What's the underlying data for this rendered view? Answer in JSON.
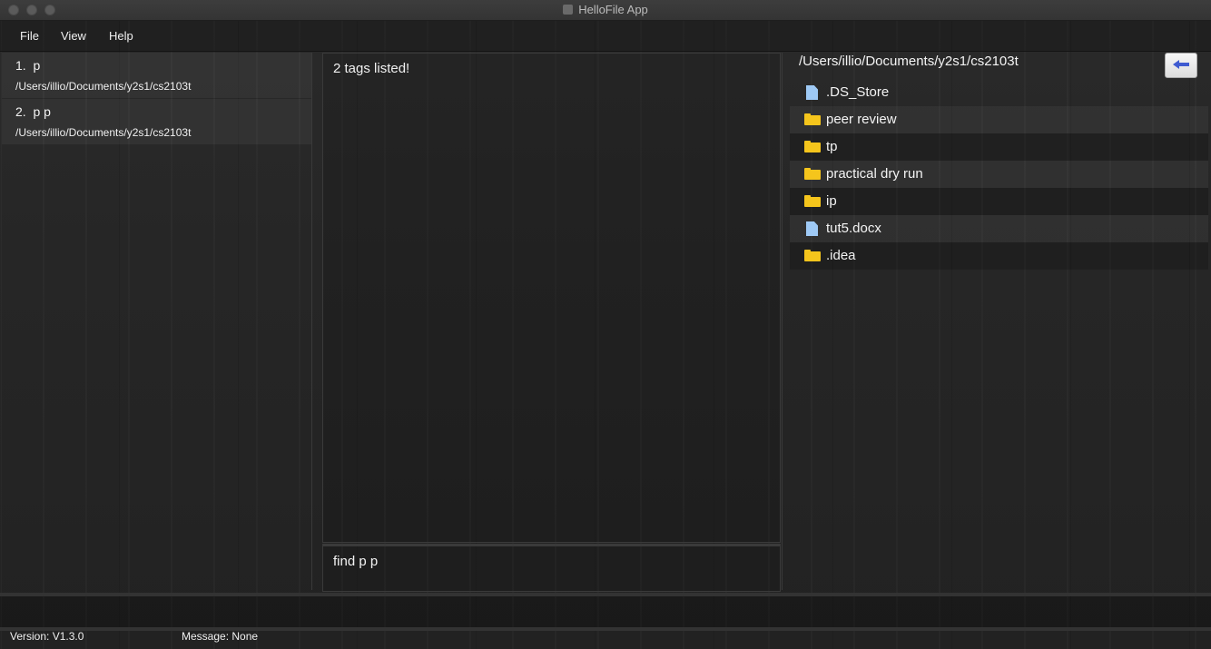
{
  "window": {
    "title": "HelloFile App"
  },
  "menu": {
    "items": [
      "File",
      "View",
      "Help"
    ]
  },
  "tags": [
    {
      "index": "1.",
      "name": "p",
      "path": "/Users/illio/Documents/y2s1/cs2103t"
    },
    {
      "index": "2.",
      "name": "p p",
      "path": "/Users/illio/Documents/y2s1/cs2103t"
    }
  ],
  "result": {
    "text": "2 tags listed!"
  },
  "command": {
    "value": "find p p"
  },
  "file_explorer": {
    "current_path": "/Users/illio/Documents/y2s1/cs2103t",
    "back_button_icon": "left-arrow-icon",
    "items": [
      {
        "name": ".DS_Store",
        "type": "file",
        "icon": "file-icon"
      },
      {
        "name": "peer review",
        "type": "folder",
        "icon": "folder-icon"
      },
      {
        "name": "tp",
        "type": "folder",
        "icon": "folder-icon"
      },
      {
        "name": "practical dry run",
        "type": "folder",
        "icon": "folder-icon"
      },
      {
        "name": "ip",
        "type": "folder",
        "icon": "folder-icon"
      },
      {
        "name": "tut5.docx",
        "type": "file",
        "icon": "file-icon"
      },
      {
        "name": ".idea",
        "type": "folder",
        "icon": "folder-icon"
      }
    ]
  },
  "status": {
    "version": "Version: V1.3.0",
    "message": "Message: None"
  },
  "colors": {
    "folder": "#f5c51c",
    "file": "#9ec9f5",
    "back_arrow": "#3f5bd1"
  }
}
